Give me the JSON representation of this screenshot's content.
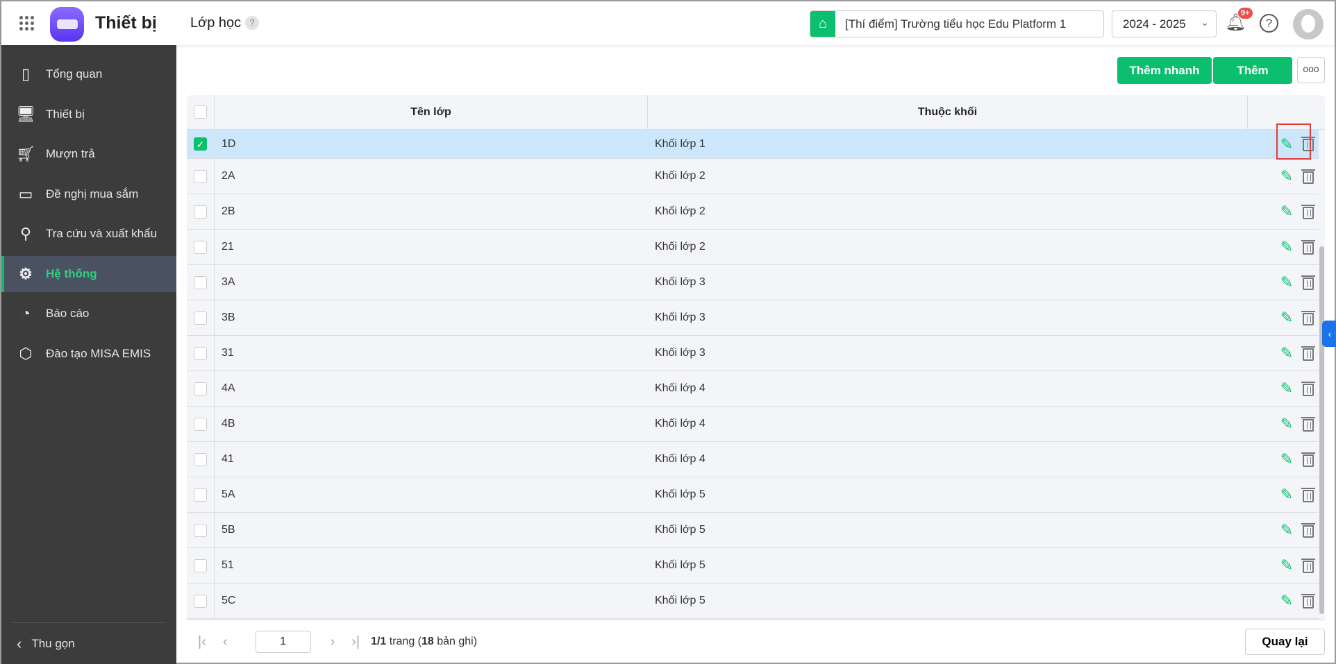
{
  "header": {
    "app_title": "Thiết bị",
    "page_title": "Lớp học",
    "help_mark": "?",
    "school": "[Thí điểm] Trường tiểu học Edu Platform 1",
    "year": "2024 - 2025",
    "notif_badge": "9+"
  },
  "sidebar": {
    "items": [
      {
        "label": "Tổng quan",
        "icon": "bar-chart-icon"
      },
      {
        "label": "Thiết bị",
        "icon": "monitor-icon"
      },
      {
        "label": "Mượn trả",
        "icon": "cart-icon"
      },
      {
        "label": "Đề nghị mua sắm",
        "icon": "projector-icon"
      },
      {
        "label": "Tra cứu và xuất khẩu",
        "icon": "search-icon"
      },
      {
        "label": "Hệ thống",
        "icon": "gear-icon",
        "active": true
      },
      {
        "label": "Báo cáo",
        "icon": "pie-chart-icon"
      },
      {
        "label": "Đào tạo MISA EMIS",
        "icon": "cube-icon"
      }
    ],
    "collapse": "Thu gọn"
  },
  "toolbar": {
    "quick_add": "Thêm nhanh",
    "add": "Thêm",
    "more": "ooo"
  },
  "table": {
    "headers": [
      "Tên lớp",
      "Thuộc khối"
    ],
    "rows": [
      {
        "name": "1D",
        "grade": "Khối lớp 1",
        "checked": true
      },
      {
        "name": "2A",
        "grade": "Khối lớp 2"
      },
      {
        "name": "2B",
        "grade": "Khối lớp 2"
      },
      {
        "name": "21",
        "grade": "Khối lớp 2"
      },
      {
        "name": "3A",
        "grade": "Khối lớp 3"
      },
      {
        "name": "3B",
        "grade": "Khối lớp 3"
      },
      {
        "name": "31",
        "grade": "Khối lớp 3"
      },
      {
        "name": "4A",
        "grade": "Khối lớp 4"
      },
      {
        "name": "4B",
        "grade": "Khối lớp 4"
      },
      {
        "name": "41",
        "grade": "Khối lớp 4"
      },
      {
        "name": "5A",
        "grade": "Khối lớp 5"
      },
      {
        "name": "5B",
        "grade": "Khối lớp 5"
      },
      {
        "name": "51",
        "grade": "Khối lớp 5"
      },
      {
        "name": "5C",
        "grade": "Khối lớp 5"
      }
    ]
  },
  "pagination": {
    "page": "1",
    "info_page": "1/1",
    "info_mid": " trang (",
    "info_count": "18",
    "info_end": " bản ghi)"
  },
  "back": "Quay lại",
  "colors": {
    "accent": "#0cbf6e",
    "selected_row": "#cce7fb",
    "sidebar": "#3c3c3c",
    "highlight": "#e53935"
  }
}
